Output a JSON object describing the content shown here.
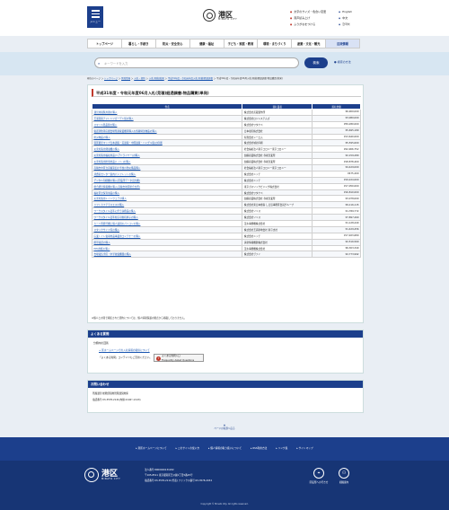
{
  "header": {
    "menu_label": "メニュー",
    "logo_kanji": "港区",
    "logo_roman": "MINATO CITY",
    "links_left": [
      "文字のサイズ・色合い変更",
      "音声読み上げ",
      "ふりがなをつける"
    ],
    "links_right": [
      "English",
      "中文",
      "한국어"
    ]
  },
  "gnav": [
    "トップページ",
    "暮らし・手続き",
    "防災・安全安心",
    "健康・福祉",
    "子ども・家庭・教育",
    "環境・まちづくり",
    "産業・文化・観光",
    "区政情報"
  ],
  "search": {
    "placeholder": "キーワードを入力",
    "button": "検索",
    "help": "検索の方法"
  },
  "breadcrumb": {
    "home": "現在のページ",
    "items": [
      "トップページ",
      "区政情報",
      "入札・契約",
      "入札(見積)結果",
      "平成31年度・令和元年度入札(見積)経過調書",
      "平成31年度・令和元年度06月入札(見積)経過調書:物品購買(単発)"
    ]
  },
  "main": {
    "title": "平成31年度・令和元年度06月入札(見積)経過調書:物品購買(単発)",
    "table": {
      "headers": [
        "件名",
        "落札業者",
        "落札金額"
      ],
      "rows": [
        [
          "運営用展覧用器の購入",
          "株式会社武蔵製作所",
          "¥6,900,000"
        ],
        [
          "芝浦港南チャレンジガーデン館の購入",
          "株式会社ロジシステムズ",
          "¥3,080,000"
        ],
        [
          "スマイル陸品庫の購入",
          "株式会社ワタナベ",
          "¥59,280,000"
        ],
        [
          "電話消防等応援会場所調査業機等購入の各種特注物品の購入",
          "日本電気株式会社",
          "¥5,695,189"
        ],
        [
          "防災物品の購入",
          "有限会社シーエム",
          "¥13,640,000"
        ],
        [
          "港区観光マップ日本語版・英語版・中国語版・ハングル版)の印刷",
          "株式会社城北印刷",
          "¥5,595,600"
        ],
        [
          "災害対策用発電機の購入",
          "社会福祉法人東京コロニー東京コロニー",
          "¥22,906,752"
        ],
        [
          "災害対策用福祉用品(ヘアドライヤー)の購入",
          "加藤産業株式会社 赤坂営業所",
          "¥2,159,280"
        ],
        [
          "災害対策用防寒用品(トイレ)の購入",
          "加藤産業株式会社 赤坂営業所",
          "¥18,878,400"
        ],
        [
          "高輪台中区立高輪第四小学校の防災備品購入",
          "社会福祉法人東京コロニー東京コロニー",
          "¥4,429,000"
        ],
        [
          "消費者センター案内パンフレットの購入",
          "株式会社ニッチ",
          "¥475,200"
        ],
        [
          "デジタル印刷機の購入(区役所データ出力機)",
          "株式会社ニッチ",
          "¥19,224,000"
        ],
        [
          "総合経営情報機の購入(高輪台地区総合支所)",
          "東京ガスリックビジング株式会社",
          "¥17,050,000"
        ],
        [
          "福祉区立保育用品の購入",
          "株式会社ワタナベ",
          "¥16,810,000"
        ],
        [
          "災害対策用レインウェアの購入",
          "加藤産業株式会社 赤坂営業所",
          "¥3,078,000"
        ],
        [
          "リフトカフテラスエスの購入",
          "株式会社東日本旅客 し日島事務区会員グループ",
          "¥9,116,115"
        ],
        [
          "ワークスタイル変革に伴う執務品の購入",
          "株式会社リソス",
          "¥1,789,772"
        ],
        [
          "ワークスタイル変革対応可動机椅子の購入",
          "株式会社リソス",
          "¥7,897,260"
        ],
        [
          "カード再発行機と個人識別のパソコンの購入",
          "茂木事務機株式会社",
          "¥1,128,440"
        ],
        [
          "スタックサイド等の購入",
          "株式会社芝浦新地会社 東京支社",
          "¥1,429,456"
        ],
        [
          "庄業トイレ電導用品事業用コンテナーの購入",
          "株式会社ニッチ",
          "¥17,923,680"
        ],
        [
          "携帯電話の購入",
          "清新情報機器株式会社",
          "¥2,516,560"
        ],
        [
          "PPC用紙の購入",
          "茂木事務機株式会社",
          "¥6,303,340"
        ],
        [
          "台場電気学区・中学校電機器の購入",
          "株式会社ヴァイ",
          "¥2,773,992"
        ]
      ]
    },
    "note": "※個人との間で締結された契約については、個人情報保護の観点から掲載しておりません。"
  },
  "faq": {
    "title": "よくある質問",
    "label": "分類内の回答",
    "link": "区ホームページでの入札情報の提供について",
    "usage": "「よくある質問」コンテンツもご活用ください。",
    "badge_title": "よくある質問入口",
    "badge_sub": "Frequently Asked Questions"
  },
  "inquiry": {
    "title": "お問い合わせ",
    "line1": "所属課室:総務部契約管理課契約係",
    "line2": "電話番号:03-3578-2141(内線:2140〜2143)"
  },
  "pagetop": "ページの先頭へ戻る",
  "footer": {
    "nav": [
      "港区ホームページについて",
      "このサイトの使い方",
      "個人情報の取り扱いについて",
      "RSS利用方法",
      "リンク集",
      "サイトマップ"
    ],
    "logo_kanji": "港区",
    "logo_roman": "MINATO CITY",
    "info": [
      "法人番号:8000020131032",
      "〒105-8511 東京都港区芝公園1丁目5番25号",
      "電話番号:03-3578-2111(代表) ファックス番号:03-3578-2034"
    ],
    "icons": [
      {
        "label": "区役所への行き方",
        "icon": "map-icon"
      },
      {
        "label": "組織案内",
        "icon": "org-icon"
      }
    ],
    "copyright": "Copyright © Minato City. All rights reserved."
  }
}
